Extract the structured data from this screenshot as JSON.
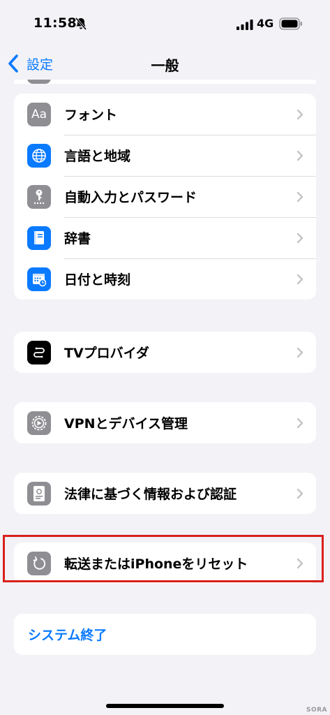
{
  "status_bar": {
    "time": "11:58",
    "network": "4G",
    "icons": [
      "bell-slash-icon",
      "signal-icon",
      "battery-icon"
    ]
  },
  "nav": {
    "back_label": "設定",
    "title": "一般"
  },
  "groups": {
    "first": [
      {
        "label": "フォント",
        "icon": "font-icon",
        "icon_color": "#8e8e93"
      },
      {
        "label": "言語と地域",
        "icon": "globe-icon",
        "icon_color": "#0a7aff"
      },
      {
        "label": "自動入力とパスワード",
        "icon": "key-icon",
        "icon_color": "#8e8e93"
      },
      {
        "label": "辞書",
        "icon": "book-icon",
        "icon_color": "#0a7aff"
      },
      {
        "label": "日付と時刻",
        "icon": "calendar-clock-icon",
        "icon_color": "#0a7aff"
      }
    ],
    "tv_provider": {
      "label": "TVプロバイダ",
      "icon": "tv-provider-icon",
      "icon_color": "#000000"
    },
    "vpn": {
      "label": "VPNとデバイス管理",
      "icon": "gear-icon",
      "icon_color": "#8e8e93"
    },
    "legal": {
      "label": "法律に基づく情報および認証",
      "icon": "legal-document-icon",
      "icon_color": "#8e8e93"
    },
    "reset": {
      "label": "転送またはiPhoneをリセット",
      "icon": "reset-arrow-icon",
      "icon_color": "#8e8e93"
    },
    "shutdown": {
      "label": "システム終了"
    }
  },
  "colors": {
    "accent": "#0a7aff",
    "highlight": "#d9201c",
    "background": "#f2f2f7"
  },
  "watermark": "SORA"
}
